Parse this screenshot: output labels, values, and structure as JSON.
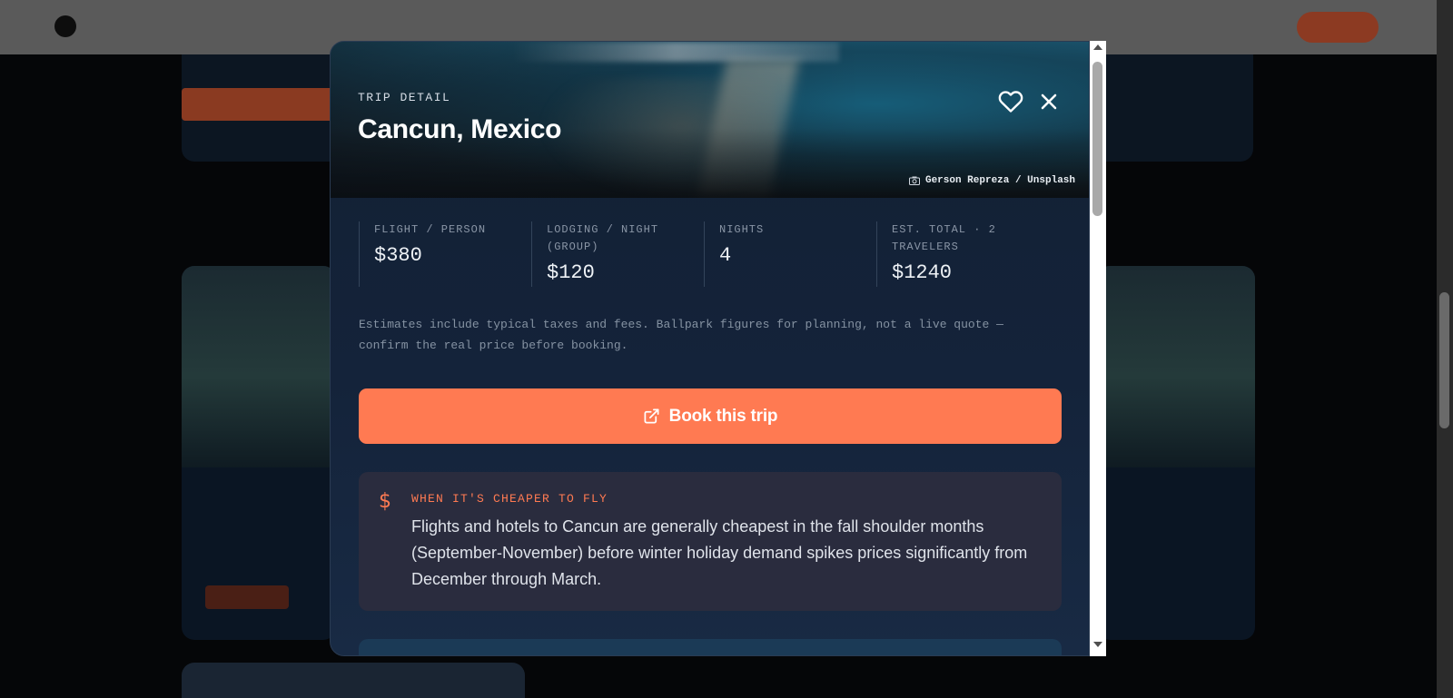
{
  "modal": {
    "eyebrow": "TRIP DETAIL",
    "title": "Cancun, Mexico",
    "favorite_icon": "heart-icon",
    "close_icon": "close-icon",
    "photo_credit": "Gerson Repreza / Unsplash",
    "photo_credit_icon": "camera-icon",
    "stats": [
      {
        "label": "FLIGHT / PERSON",
        "value": "$380"
      },
      {
        "label": "LODGING / NIGHT (GROUP)",
        "value": "$120"
      },
      {
        "label": "NIGHTS",
        "value": "4"
      },
      {
        "label": "EST. TOTAL · 2 TRAVELERS",
        "value": "$1240"
      }
    ],
    "note": "Estimates include typical taxes and fees. Ballpark figures for planning, not a live quote — confirm the real price before booking.",
    "book_button": {
      "label": "Book this trip",
      "icon": "external-link-icon"
    },
    "tip": {
      "icon": "$",
      "label": "WHEN IT'S CHEAPER TO FLY",
      "text": "Flights and hotels to Cancun are generally cheapest in the fall shoulder months (September-November) before winter holiday demand spikes prices significantly from December through March."
    }
  },
  "colors": {
    "accent": "#ff7a52",
    "modal_bg": "#14233a",
    "tip_bg": "#2a2c3e"
  }
}
